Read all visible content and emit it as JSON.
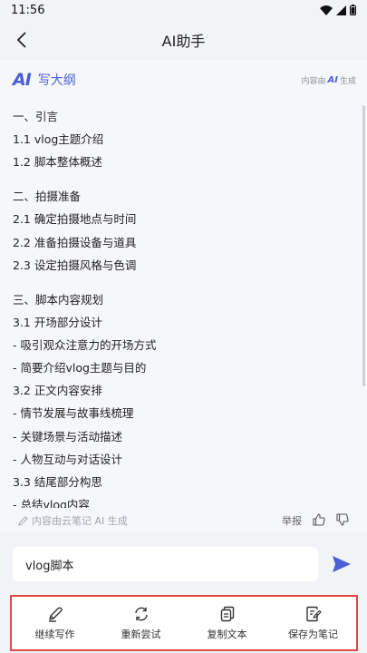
{
  "status_bar": {
    "time": "11:56"
  },
  "nav": {
    "title": "AI助手"
  },
  "ai_card": {
    "logo": "AI",
    "title": "写大纲",
    "badge_prefix": "内容由",
    "badge_ai": "AI",
    "badge_suffix": "生成",
    "outline": [
      "一、引言",
      "1.1 vlog主题介绍",
      "1.2 脚本整体概述",
      "二、拍摄准备",
      "2.1 确定拍摄地点与时间",
      "2.2 准备拍摄设备与道具",
      "2.3 设定拍摄风格与色调",
      "三、脚本内容规划",
      "3.1 开场部分设计",
      "- 吸引观众注意力的开场方式",
      "- 简要介绍vlog主题与目的",
      "3.2 正文内容安排",
      "- 情节发展与故事线梳理",
      "- 关键场景与活动描述",
      "- 人物互动与对话设计",
      "3.3 结尾部分构思",
      "- 总结vlog内容"
    ],
    "footer_note": "内容由云笔记 AI 生成",
    "report_label": "举报"
  },
  "input": {
    "value": "vlog脚本"
  },
  "actions": [
    {
      "label": "继续写作",
      "icon": "pen-icon"
    },
    {
      "label": "重新尝试",
      "icon": "refresh-icon"
    },
    {
      "label": "复制文本",
      "icon": "copy-icon"
    },
    {
      "label": "保存为笔记",
      "icon": "save-note-icon"
    }
  ],
  "colors": {
    "accent": "#4a5fd6",
    "highlight_border": "#e14848",
    "background": "#f2f3f7"
  }
}
